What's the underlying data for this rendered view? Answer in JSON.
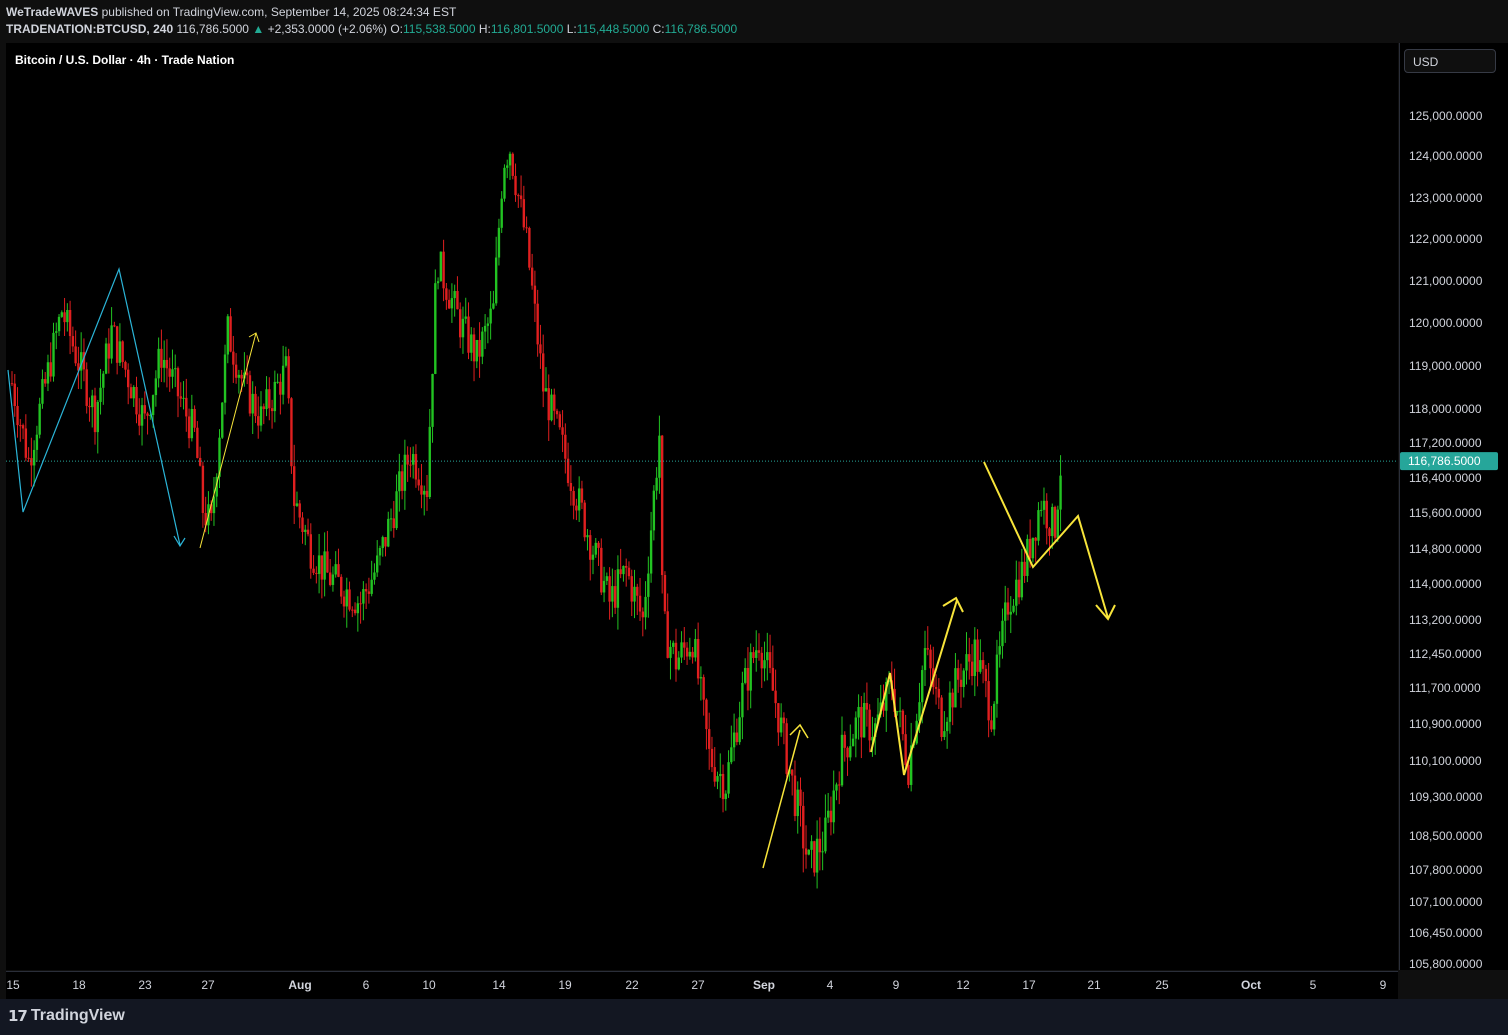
{
  "header": {
    "author": "WeTradeWAVES",
    "published_text": "published on TradingView.com, September 14, 2025 08:24:34 EST",
    "symbol": "TRADENATION:BTCUSD, 240",
    "last": "116,786.5000",
    "change": "+2,353.0000 (+2.06%)",
    "o_label": "O:",
    "o": "115,538.5000",
    "h_label": "H:",
    "h": "116,801.5000",
    "l_label": "L:",
    "l": "115,448.5000",
    "c_label": "C:",
    "c": "116,786.5000"
  },
  "chart_title": "Bitcoin / U.S. Dollar · 4h · Trade Nation",
  "currency": "USD",
  "footer": {
    "brand": "TradingView"
  },
  "colors": {
    "up": "#089981",
    "down": "#f23645",
    "candle_up": "#22c322",
    "candle_down": "#e01f1f",
    "projection": "#f7e43a",
    "cyan_wave": "#2bb5d8",
    "last_price": "#26a69a"
  },
  "chart_data": {
    "type": "candlestick",
    "title": "Bitcoin / U.S. Dollar · 4h · Trade Nation",
    "last_price": 116786.5,
    "last_price_label": "116,786.5000",
    "y_ticks": [
      "125,000.0000",
      "124,000.0000",
      "123,000.0000",
      "122,000.0000",
      "121,000.0000",
      "120,000.0000",
      "119,000.0000",
      "118,000.0000",
      "117,200.0000",
      "116,400.0000",
      "115,600.0000",
      "114,800.0000",
      "114,000.0000",
      "113,200.0000",
      "112,450.0000",
      "111,700.0000",
      "110,900.0000",
      "110,100.0000",
      "109,300.0000",
      "108,500.0000",
      "107,800.0000",
      "107,100.0000",
      "106,450.0000",
      "105,800.0000"
    ],
    "x_ticks": [
      "15",
      "18",
      "23",
      "27",
      "Aug",
      "6",
      "10",
      "14",
      "19",
      "22",
      "27",
      "Sep",
      "4",
      "9",
      "12",
      "17",
      "21",
      "25",
      "Oct",
      "5",
      "9"
    ],
    "bold_x_ticks": [
      "Aug",
      "Sep",
      "Oct"
    ],
    "swing_points": [
      {
        "date": "Jul 15",
        "price": 118800
      },
      {
        "date": "Jul 15",
        "price": 116000
      },
      {
        "date": "Jul 18",
        "price": 120700
      },
      {
        "date": "Jul 23",
        "price": 117500
      },
      {
        "date": "Jul 25",
        "price": 115300
      },
      {
        "date": "Jul 31",
        "price": 119900
      },
      {
        "date": "Aug 14",
        "price": 124400
      },
      {
        "date": "Sep 1",
        "price": 107400
      },
      {
        "date": "Sep 12",
        "price": 116000
      },
      {
        "date": "Sep 13",
        "price": 116786.5
      }
    ],
    "projection": [
      {
        "date": "Sep 13",
        "price": 116786.5
      },
      {
        "date": "Sep 16",
        "price": 114200
      },
      {
        "date": "Sep 20",
        "price": 115600
      },
      {
        "date": "Sep 22",
        "price": 113300
      }
    ]
  }
}
